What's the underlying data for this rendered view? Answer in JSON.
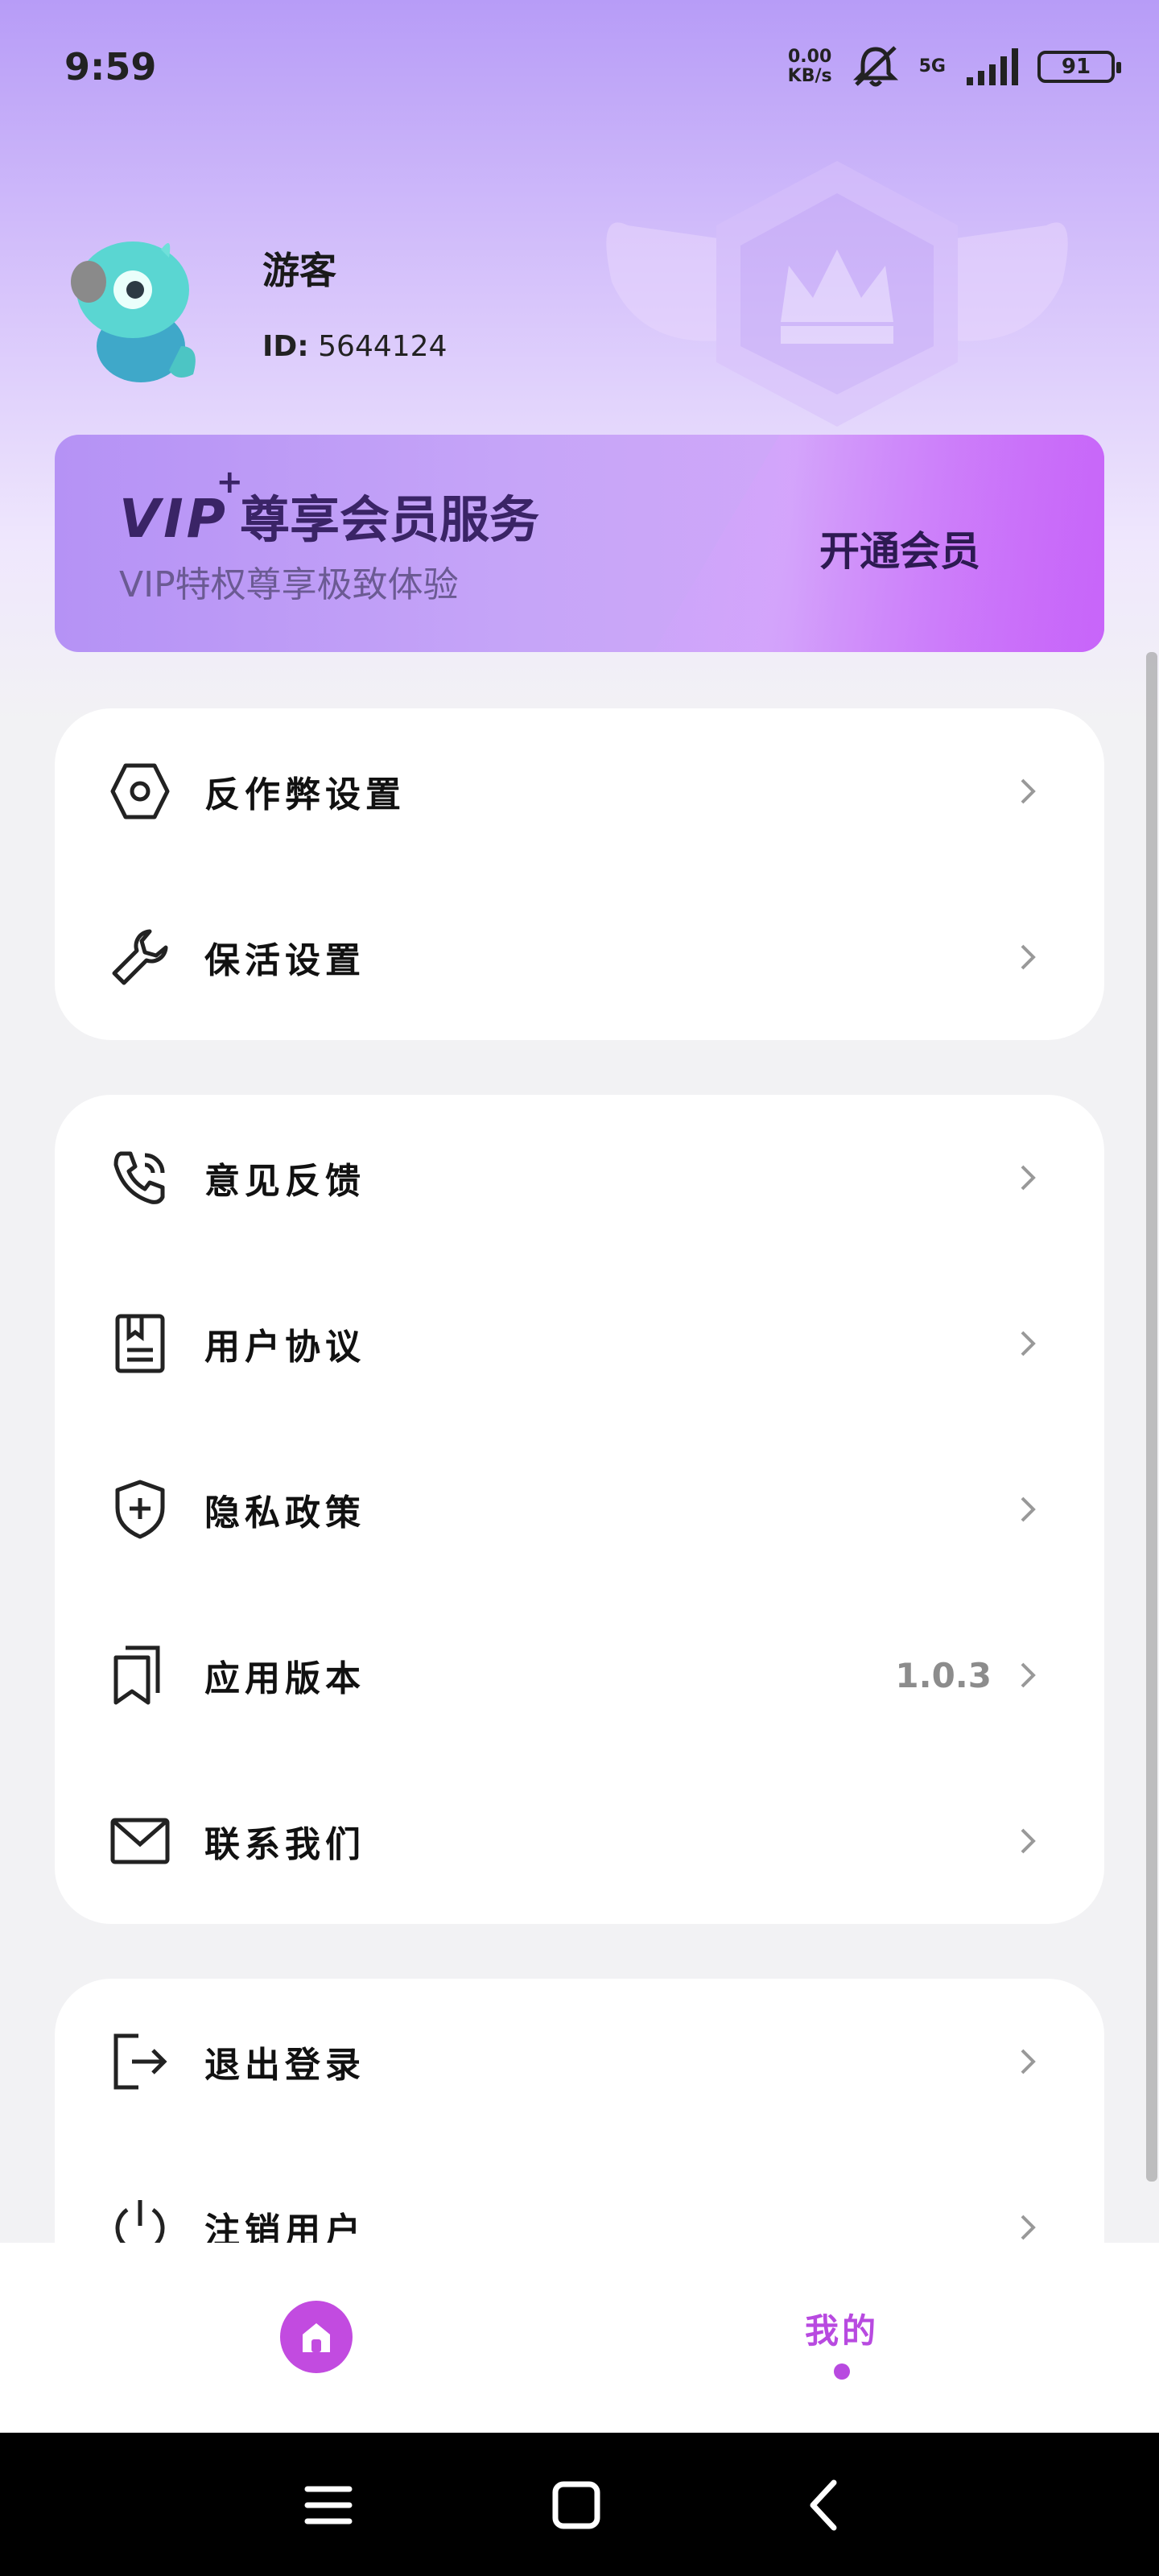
{
  "status_bar": {
    "time": "9:59",
    "net_speed_value": "0.00",
    "net_speed_unit": "KB/s",
    "network": "5G",
    "battery": "91"
  },
  "profile": {
    "username": "游客",
    "id_label": "ID:",
    "id_value": "5644124"
  },
  "vip_banner": {
    "mark": "VIP",
    "mark_plus": "+",
    "title": "尊享会员服务",
    "subtitle": "VIP特权尊享极致体验",
    "button_label": "开通会员"
  },
  "settings_card": [
    {
      "label": "反作弊设置",
      "icon": "hexagon-nut-icon"
    },
    {
      "label": "保活设置",
      "icon": "wrench-icon"
    }
  ],
  "info_card": [
    {
      "label": "意见反馈",
      "icon": "phone-call-icon"
    },
    {
      "label": "用户协议",
      "icon": "document-icon"
    },
    {
      "label": "隐私政策",
      "icon": "shield-plus-icon"
    },
    {
      "label": "应用版本",
      "icon": "bookmark-copy-icon",
      "value": "1.0.3"
    },
    {
      "label": "联系我们",
      "icon": "mail-icon"
    }
  ],
  "account_card": [
    {
      "label": "退出登录",
      "icon": "logout-icon"
    },
    {
      "label": "注销用户",
      "icon": "power-icon"
    }
  ],
  "tab_bar": {
    "home_icon": "home-icon",
    "mine_label": "我的"
  },
  "colors": {
    "accent": "#b84ae0",
    "vip_text": "#3a2466",
    "background": "#f2f2f4"
  }
}
